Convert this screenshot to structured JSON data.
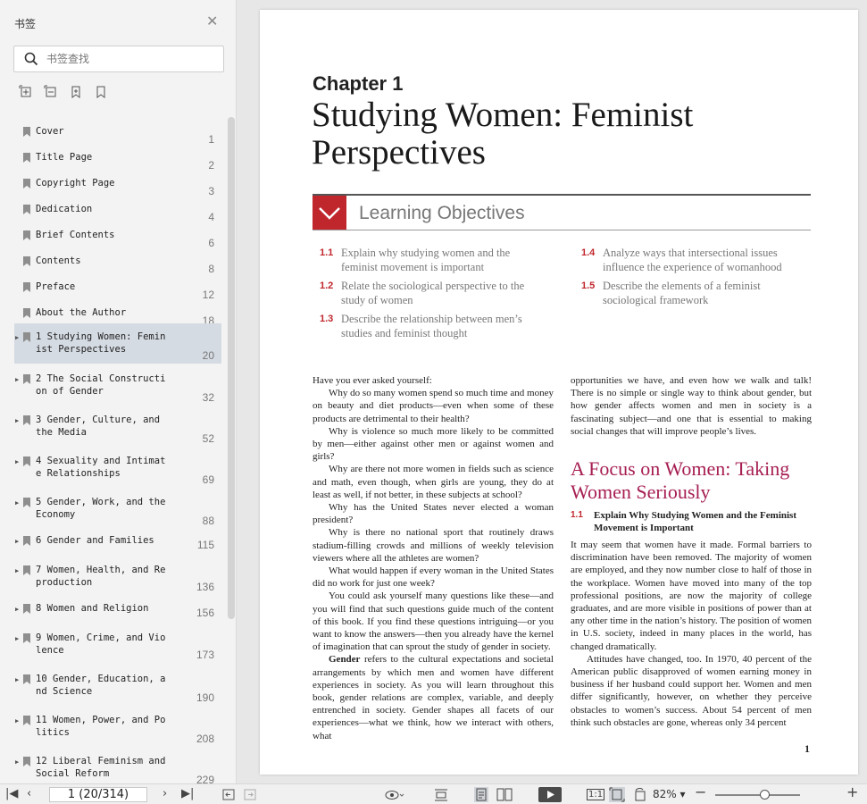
{
  "sidebar": {
    "title": "书签",
    "search_placeholder": "书签查找",
    "bookmarks": [
      {
        "label": "Cover",
        "page": "1"
      },
      {
        "label": "Title Page",
        "page": "2"
      },
      {
        "label": "Copyright Page",
        "page": "3"
      },
      {
        "label": "Dedication",
        "page": "4"
      },
      {
        "label": "Brief Contents",
        "page": "6"
      },
      {
        "label": "Contents",
        "page": "8"
      },
      {
        "label": "Preface",
        "page": "12"
      },
      {
        "label": "About the Author",
        "page": "18"
      },
      {
        "label": "1 Studying Women: Feminist Perspectives",
        "page": "20",
        "expandable": true,
        "selected": true
      },
      {
        "label": "2 The Social Construction of Gender",
        "page": "32",
        "expandable": true
      },
      {
        "label": "3 Gender, Culture, and the Media",
        "page": "52",
        "expandable": true
      },
      {
        "label": "4 Sexuality and Intimate Relationships",
        "page": "69",
        "expandable": true
      },
      {
        "label": "5 Gender, Work, and the Economy",
        "page": "88",
        "expandable": true
      },
      {
        "label": "6 Gender and Families",
        "page": "115",
        "expandable": true
      },
      {
        "label": "7 Women, Health, and Reproduction",
        "page": "136",
        "expandable": true
      },
      {
        "label": "8 Women and Religion",
        "page": "156",
        "expandable": true
      },
      {
        "label": "9 Women, Crime, and Violence",
        "page": "173",
        "expandable": true
      },
      {
        "label": "10 Gender, Education, and Science",
        "page": "190",
        "expandable": true
      },
      {
        "label": "11 Women, Power, and Politics",
        "page": "208",
        "expandable": true
      },
      {
        "label": "12 Liberal Feminism and Social Reform",
        "page": "229",
        "expandable": true
      }
    ]
  },
  "document": {
    "chapter_label": "Chapter 1",
    "chapter_title": "Studying Women: Feminist Perspectives",
    "objectives_heading": "Learning Objectives",
    "objectives": [
      {
        "num": "1.1",
        "text": "Explain why studying women and the feminist movement is important"
      },
      {
        "num": "1.2",
        "text": "Relate the sociological perspective to the study of women"
      },
      {
        "num": "1.3",
        "text": "Describe the relationship between men’s studies and feminist thought"
      },
      {
        "num": "1.4",
        "text": "Analyze ways that intersectional issues influence the experience of womanhood"
      },
      {
        "num": "1.5",
        "text": "Describe the elements of a feminist sociological framework"
      }
    ],
    "col1_paragraphs": [
      "Have you ever asked yourself:",
      "Why do so many women spend so much time and money on beauty and diet products—even when some of these products are detrimental to their health?",
      "Why is violence so much more likely to be committed by men—either against other men or against women and girls?",
      "Why are there not more women in fields such as science and math, even though, when girls are young, they do at least as well, if not better, in these subjects at school?",
      "Why has the United States never elected a woman president?",
      "Why is there no national sport that routinely draws stadium-filling crowds and millions of weekly television viewers where all the athletes are women?",
      "What would happen if every woman in the United States did no work for just one week?",
      "You could ask yourself many questions like these—and you will find that such questions guide much of the content of this book. If you find these questions intriguing—or you want to know the answers—then you already have the kernel of imagination that can sprout the study of gender in society."
    ],
    "gender_term": "Gender",
    "gender_para": " refers to the cultural expectations and societal arrangements by which men and women have different experiences in society. As you will learn throughout this book, gender relations are complex, variable, and deeply entrenched in society. Gender shapes all facets of our experiences—what we think, how we interact with others, what",
    "col2_top": "opportunities we have, and even how we walk and talk! There is no simple or single way to think about gender, but how gender affects women and men in society is a fascinating subject—and one that is essential to making social changes that will improve people’s lives.",
    "section_heading": "A Focus on Women: Taking Women Seriously",
    "sub_num": "1.1",
    "sub_text": "Explain Why Studying Women and the Feminist Movement is Important",
    "col2_p1": "It may seem that women have it made. Formal barriers to discrimination have been removed. The majority of women are employed, and they now number close to half of those in the workplace. Women have moved into many of the top professional positions, are now the majority of college graduates, and are more visible in positions of power than at any other time in the nation’s history. The position of women in U.S. society, indeed in many places in the world, has changed dramatically.",
    "col2_p2": "Attitudes have changed, too. In 1970, 40 percent of the American public disapproved of women earning money in business if her husband could support her. Women and men differ significantly, however, on whether they perceive obstacles to women’s success. About 54 percent of men think such obstacles are gone, whereas only 34 percent",
    "page_number": "1"
  },
  "toolbar": {
    "page_display": "1 (20/314)",
    "zoom": "82%",
    "zoom_level": 0.58
  },
  "colors": {
    "accent_red": "#c0272d",
    "heading_magenta": "#a61e52",
    "selected_bg": "#d5dbe3"
  }
}
